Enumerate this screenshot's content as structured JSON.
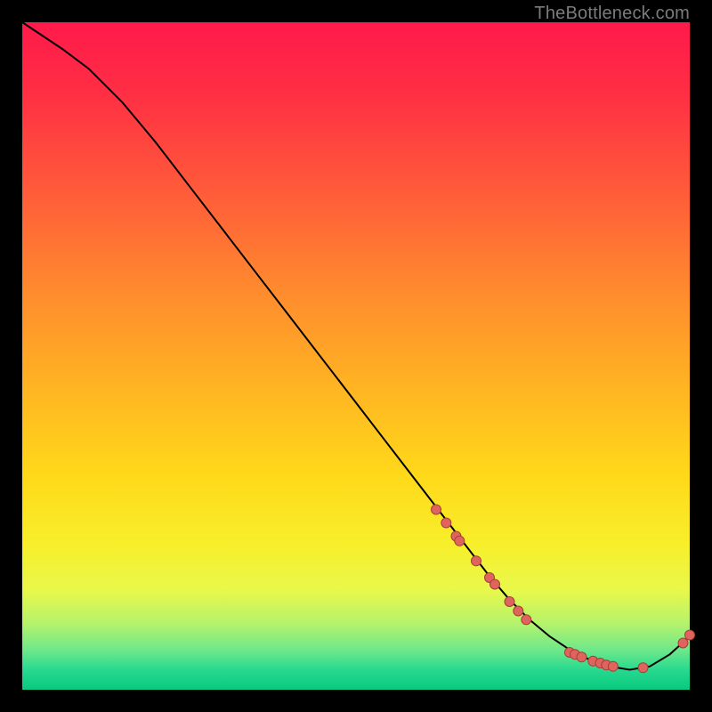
{
  "watermark": "TheBottleneck.com",
  "colors": {
    "gradient_top": "#ff1a4b",
    "gradient_bottom": "#08c97f",
    "curve": "#000000",
    "point_fill": "#e0645e",
    "point_stroke": "#a53f3a",
    "frame": "#000000"
  },
  "chart_data": {
    "type": "line",
    "title": "",
    "xlabel": "",
    "ylabel": "",
    "xlim": [
      0,
      100
    ],
    "ylim": [
      0,
      100
    ],
    "note": "Axes are unlabeled in the source image; units normalized to 0–100 along each axis. Curve values estimated from pixel positions.",
    "series": [
      {
        "name": "bottleneck-curve",
        "x": [
          0,
          3,
          6,
          10,
          15,
          20,
          25,
          30,
          35,
          40,
          45,
          50,
          55,
          60,
          65,
          70,
          73,
          76,
          79,
          82,
          85,
          88,
          91,
          94,
          97,
          100
        ],
        "y": [
          100,
          98,
          96,
          93,
          88,
          82,
          75.5,
          69,
          62.5,
          56,
          49.5,
          43,
          36.5,
          30,
          23.5,
          17,
          13.5,
          10.5,
          8,
          6,
          4.5,
          3.5,
          3,
          3.5,
          5.3,
          8
        ]
      }
    ],
    "markers": {
      "name": "highlighted-points",
      "points": [
        {
          "x": 62,
          "y": 27
        },
        {
          "x": 63.5,
          "y": 25
        },
        {
          "x": 65,
          "y": 23
        },
        {
          "x": 65.5,
          "y": 22.3
        },
        {
          "x": 68,
          "y": 19.3
        },
        {
          "x": 70,
          "y": 16.8
        },
        {
          "x": 70.8,
          "y": 15.8
        },
        {
          "x": 73,
          "y": 13.2
        },
        {
          "x": 74.3,
          "y": 11.8
        },
        {
          "x": 75.5,
          "y": 10.5
        },
        {
          "x": 82,
          "y": 5.6
        },
        {
          "x": 82.8,
          "y": 5.3
        },
        {
          "x": 83.8,
          "y": 4.9
        },
        {
          "x": 85.5,
          "y": 4.3
        },
        {
          "x": 86.6,
          "y": 4
        },
        {
          "x": 87.5,
          "y": 3.7
        },
        {
          "x": 88.5,
          "y": 3.5
        },
        {
          "x": 93,
          "y": 3.3
        },
        {
          "x": 99,
          "y": 7
        },
        {
          "x": 100,
          "y": 8.2
        }
      ]
    }
  }
}
